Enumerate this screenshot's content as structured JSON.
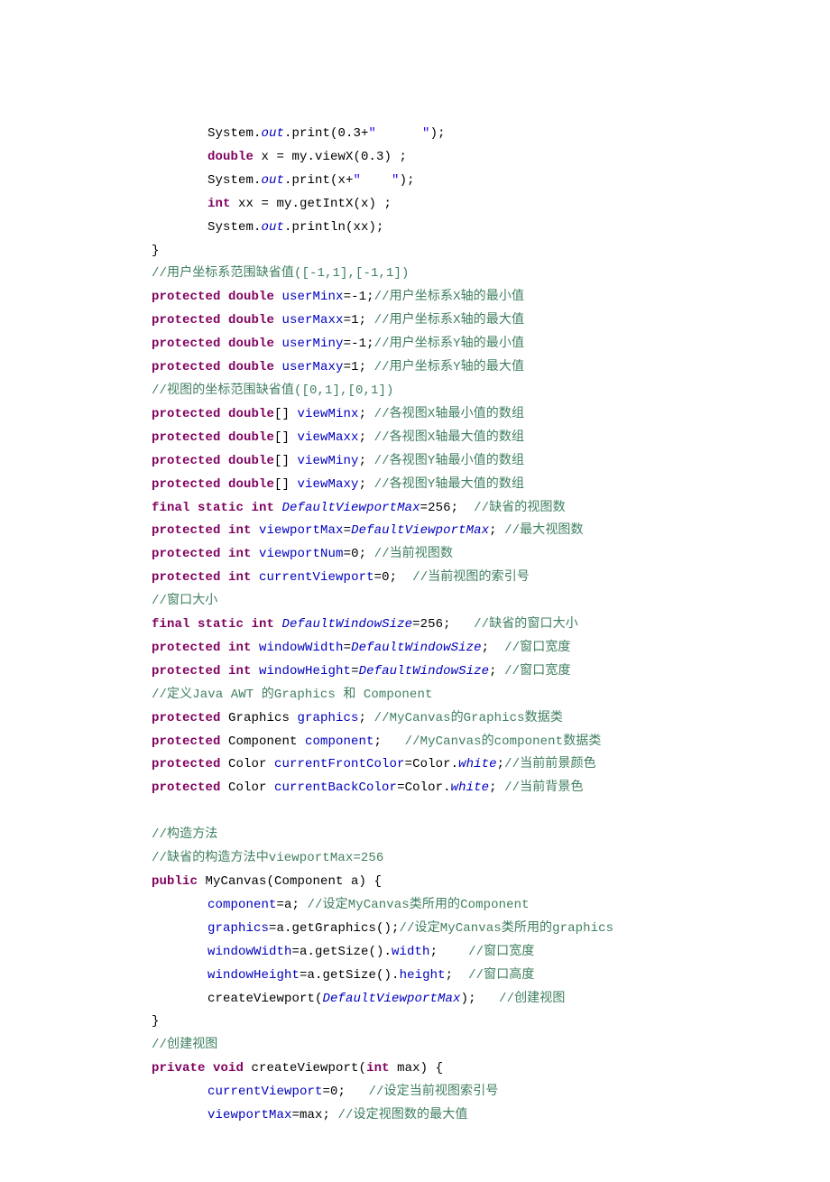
{
  "lines": [
    {
      "indent": 1,
      "segs": [
        {
          "c": "type",
          "t": "System."
        },
        {
          "c": "it",
          "t": "out"
        },
        {
          "c": "type",
          "t": ".print(0.3+"
        },
        {
          "c": "st",
          "t": "\"      \""
        },
        {
          "c": "type",
          "t": ");"
        }
      ]
    },
    {
      "indent": 1,
      "segs": [
        {
          "c": "kw",
          "t": "double"
        },
        {
          "c": "type",
          "t": " x = my.viewX(0.3) ;"
        }
      ]
    },
    {
      "indent": 1,
      "segs": [
        {
          "c": "type",
          "t": "System."
        },
        {
          "c": "it",
          "t": "out"
        },
        {
          "c": "type",
          "t": ".print(x+"
        },
        {
          "c": "st",
          "t": "\"    \""
        },
        {
          "c": "type",
          "t": ");"
        }
      ]
    },
    {
      "indent": 1,
      "segs": [
        {
          "c": "kw",
          "t": "int"
        },
        {
          "c": "type",
          "t": " xx = my.getIntX(x) ;"
        }
      ]
    },
    {
      "indent": 1,
      "segs": [
        {
          "c": "type",
          "t": "System."
        },
        {
          "c": "it",
          "t": "out"
        },
        {
          "c": "type",
          "t": ".println(xx);"
        }
      ]
    },
    {
      "indent": 0,
      "segs": [
        {
          "c": "type",
          "t": "}"
        }
      ]
    },
    {
      "indent": 0,
      "segs": [
        {
          "c": "cm",
          "t": "//用户坐标系范围缺省值([-1,1],[-1,1])"
        }
      ]
    },
    {
      "indent": 0,
      "segs": [
        {
          "c": "kw",
          "t": "protected double"
        },
        {
          "c": "type",
          "t": " "
        },
        {
          "c": "fld",
          "t": "userMinx"
        },
        {
          "c": "type",
          "t": "=-1;"
        },
        {
          "c": "cm",
          "t": "//用户坐标系X轴的最小值"
        }
      ]
    },
    {
      "indent": 0,
      "segs": [
        {
          "c": "kw",
          "t": "protected double"
        },
        {
          "c": "type",
          "t": " "
        },
        {
          "c": "fld",
          "t": "userMaxx"
        },
        {
          "c": "type",
          "t": "=1; "
        },
        {
          "c": "cm",
          "t": "//用户坐标系X轴的最大值"
        }
      ]
    },
    {
      "indent": 0,
      "segs": [
        {
          "c": "kw",
          "t": "protected double"
        },
        {
          "c": "type",
          "t": " "
        },
        {
          "c": "fld",
          "t": "userMiny"
        },
        {
          "c": "type",
          "t": "=-1;"
        },
        {
          "c": "cm",
          "t": "//用户坐标系Y轴的最小值"
        }
      ]
    },
    {
      "indent": 0,
      "segs": [
        {
          "c": "kw",
          "t": "protected double"
        },
        {
          "c": "type",
          "t": " "
        },
        {
          "c": "fld",
          "t": "userMaxy"
        },
        {
          "c": "type",
          "t": "=1; "
        },
        {
          "c": "cm",
          "t": "//用户坐标系Y轴的最大值"
        }
      ]
    },
    {
      "indent": 0,
      "segs": [
        {
          "c": "cm",
          "t": "//视图的坐标范围缺省值([0,1],[0,1])"
        }
      ]
    },
    {
      "indent": 0,
      "segs": [
        {
          "c": "kw",
          "t": "protected double"
        },
        {
          "c": "type",
          "t": "[] "
        },
        {
          "c": "fld",
          "t": "viewMinx"
        },
        {
          "c": "type",
          "t": "; "
        },
        {
          "c": "cm",
          "t": "//各视图X轴最小值的数组"
        }
      ]
    },
    {
      "indent": 0,
      "segs": [
        {
          "c": "kw",
          "t": "protected double"
        },
        {
          "c": "type",
          "t": "[] "
        },
        {
          "c": "fld",
          "t": "viewMaxx"
        },
        {
          "c": "type",
          "t": "; "
        },
        {
          "c": "cm",
          "t": "//各视图X轴最大值的数组"
        }
      ]
    },
    {
      "indent": 0,
      "segs": [
        {
          "c": "kw",
          "t": "protected double"
        },
        {
          "c": "type",
          "t": "[] "
        },
        {
          "c": "fld",
          "t": "viewMiny"
        },
        {
          "c": "type",
          "t": "; "
        },
        {
          "c": "cm",
          "t": "//各视图Y轴最小值的数组"
        }
      ]
    },
    {
      "indent": 0,
      "segs": [
        {
          "c": "kw",
          "t": "protected double"
        },
        {
          "c": "type",
          "t": "[] "
        },
        {
          "c": "fld",
          "t": "viewMaxy"
        },
        {
          "c": "type",
          "t": "; "
        },
        {
          "c": "cm",
          "t": "//各视图Y轴最大值的数组"
        }
      ]
    },
    {
      "indent": 0,
      "segs": [
        {
          "c": "kw",
          "t": "final static int"
        },
        {
          "c": "type",
          "t": " "
        },
        {
          "c": "it",
          "t": "DefaultViewportMax"
        },
        {
          "c": "type",
          "t": "=256;  "
        },
        {
          "c": "cm",
          "t": "//缺省的视图数"
        }
      ]
    },
    {
      "indent": 0,
      "segs": [
        {
          "c": "kw",
          "t": "protected int"
        },
        {
          "c": "type",
          "t": " "
        },
        {
          "c": "fld",
          "t": "viewportMax"
        },
        {
          "c": "type",
          "t": "="
        },
        {
          "c": "it",
          "t": "DefaultViewportMax"
        },
        {
          "c": "type",
          "t": "; "
        },
        {
          "c": "cm",
          "t": "//最大视图数"
        }
      ]
    },
    {
      "indent": 0,
      "segs": [
        {
          "c": "kw",
          "t": "protected int"
        },
        {
          "c": "type",
          "t": " "
        },
        {
          "c": "fld",
          "t": "viewportNum"
        },
        {
          "c": "type",
          "t": "=0; "
        },
        {
          "c": "cm",
          "t": "//当前视图数"
        }
      ]
    },
    {
      "indent": 0,
      "segs": [
        {
          "c": "kw",
          "t": "protected int"
        },
        {
          "c": "type",
          "t": " "
        },
        {
          "c": "fld",
          "t": "currentViewport"
        },
        {
          "c": "type",
          "t": "=0;  "
        },
        {
          "c": "cm",
          "t": "//当前视图的索引号"
        }
      ]
    },
    {
      "indent": 0,
      "segs": [
        {
          "c": "cm",
          "t": "//窗口大小"
        }
      ]
    },
    {
      "indent": 0,
      "segs": [
        {
          "c": "kw",
          "t": "final static int"
        },
        {
          "c": "type",
          "t": " "
        },
        {
          "c": "it",
          "t": "DefaultWindowSize"
        },
        {
          "c": "type",
          "t": "=256;   "
        },
        {
          "c": "cm",
          "t": "//缺省的窗口大小"
        }
      ]
    },
    {
      "indent": 0,
      "segs": [
        {
          "c": "kw",
          "t": "protected int"
        },
        {
          "c": "type",
          "t": " "
        },
        {
          "c": "fld",
          "t": "windowWidth"
        },
        {
          "c": "type",
          "t": "="
        },
        {
          "c": "it",
          "t": "DefaultWindowSize"
        },
        {
          "c": "type",
          "t": ";  "
        },
        {
          "c": "cm",
          "t": "//窗口宽度"
        }
      ]
    },
    {
      "indent": 0,
      "segs": [
        {
          "c": "kw",
          "t": "protected int"
        },
        {
          "c": "type",
          "t": " "
        },
        {
          "c": "fld",
          "t": "windowHeight"
        },
        {
          "c": "type",
          "t": "="
        },
        {
          "c": "it",
          "t": "DefaultWindowSize"
        },
        {
          "c": "type",
          "t": "; "
        },
        {
          "c": "cm",
          "t": "//窗口宽度"
        }
      ]
    },
    {
      "indent": 0,
      "segs": [
        {
          "c": "cm",
          "t": "//定义Java AWT 的Graphics 和 Component"
        }
      ]
    },
    {
      "indent": 0,
      "segs": [
        {
          "c": "kw",
          "t": "protected"
        },
        {
          "c": "type",
          "t": " Graphics "
        },
        {
          "c": "fld",
          "t": "graphics"
        },
        {
          "c": "type",
          "t": "; "
        },
        {
          "c": "cm",
          "t": "//MyCanvas的Graphics数据类"
        }
      ]
    },
    {
      "indent": 0,
      "segs": [
        {
          "c": "kw",
          "t": "protected"
        },
        {
          "c": "type",
          "t": " Component "
        },
        {
          "c": "fld",
          "t": "component"
        },
        {
          "c": "type",
          "t": ";   "
        },
        {
          "c": "cm",
          "t": "//MyCanvas的component数据类"
        }
      ]
    },
    {
      "indent": 0,
      "segs": [
        {
          "c": "kw",
          "t": "protected"
        },
        {
          "c": "type",
          "t": " Color "
        },
        {
          "c": "fld",
          "t": "currentFrontColor"
        },
        {
          "c": "type",
          "t": "=Color."
        },
        {
          "c": "it",
          "t": "white"
        },
        {
          "c": "type",
          "t": ";"
        },
        {
          "c": "cm",
          "t": "//当前前景颜色"
        }
      ]
    },
    {
      "indent": 0,
      "segs": [
        {
          "c": "kw",
          "t": "protected"
        },
        {
          "c": "type",
          "t": " Color "
        },
        {
          "c": "fld",
          "t": "currentBackColor"
        },
        {
          "c": "type",
          "t": "=Color."
        },
        {
          "c": "it",
          "t": "white"
        },
        {
          "c": "type",
          "t": "; "
        },
        {
          "c": "cm",
          "t": "//当前背景色"
        }
      ]
    },
    {
      "indent": 0,
      "segs": [
        {
          "c": "type",
          "t": " "
        }
      ]
    },
    {
      "indent": 0,
      "segs": [
        {
          "c": "cm",
          "t": "//构造方法"
        }
      ]
    },
    {
      "indent": 0,
      "segs": [
        {
          "c": "cm",
          "t": "//缺省的构造方法中viewportMax=256"
        }
      ]
    },
    {
      "indent": 0,
      "segs": [
        {
          "c": "kw",
          "t": "public"
        },
        {
          "c": "type",
          "t": " MyCanvas(Component a) {"
        }
      ]
    },
    {
      "indent": 1,
      "segs": [
        {
          "c": "fld",
          "t": "component"
        },
        {
          "c": "type",
          "t": "=a; "
        },
        {
          "c": "cm",
          "t": "//设定MyCanvas类所用的Component"
        }
      ]
    },
    {
      "indent": 1,
      "segs": [
        {
          "c": "fld",
          "t": "graphics"
        },
        {
          "c": "type",
          "t": "=a.getGraphics();"
        },
        {
          "c": "cm",
          "t": "//设定MyCanvas类所用的graphics"
        }
      ]
    },
    {
      "indent": 1,
      "segs": [
        {
          "c": "fld",
          "t": "windowWidth"
        },
        {
          "c": "type",
          "t": "=a.getSize()."
        },
        {
          "c": "fld",
          "t": "width"
        },
        {
          "c": "type",
          "t": ";    "
        },
        {
          "c": "cm",
          "t": "//窗口宽度"
        }
      ]
    },
    {
      "indent": 1,
      "segs": [
        {
          "c": "fld",
          "t": "windowHeight"
        },
        {
          "c": "type",
          "t": "=a.getSize()."
        },
        {
          "c": "fld",
          "t": "height"
        },
        {
          "c": "type",
          "t": ";  "
        },
        {
          "c": "cm",
          "t": "//窗口高度"
        }
      ]
    },
    {
      "indent": 1,
      "segs": [
        {
          "c": "type",
          "t": "createViewport("
        },
        {
          "c": "it",
          "t": "DefaultViewportMax"
        },
        {
          "c": "type",
          "t": ");   "
        },
        {
          "c": "cm",
          "t": "//创建视图"
        }
      ]
    },
    {
      "indent": 0,
      "segs": [
        {
          "c": "type",
          "t": "}"
        }
      ]
    },
    {
      "indent": 0,
      "segs": [
        {
          "c": "cm",
          "t": "//创建视图"
        }
      ]
    },
    {
      "indent": 0,
      "segs": [
        {
          "c": "kw",
          "t": "private void"
        },
        {
          "c": "type",
          "t": " createViewport("
        },
        {
          "c": "kw",
          "t": "int"
        },
        {
          "c": "type",
          "t": " max) {"
        }
      ]
    },
    {
      "indent": 1,
      "segs": [
        {
          "c": "fld",
          "t": "currentViewport"
        },
        {
          "c": "type",
          "t": "=0;   "
        },
        {
          "c": "cm",
          "t": "//设定当前视图索引号"
        }
      ]
    },
    {
      "indent": 1,
      "segs": [
        {
          "c": "fld",
          "t": "viewportMax"
        },
        {
          "c": "type",
          "t": "=max; "
        },
        {
          "c": "cm",
          "t": "//设定视图数的最大值"
        }
      ]
    }
  ]
}
